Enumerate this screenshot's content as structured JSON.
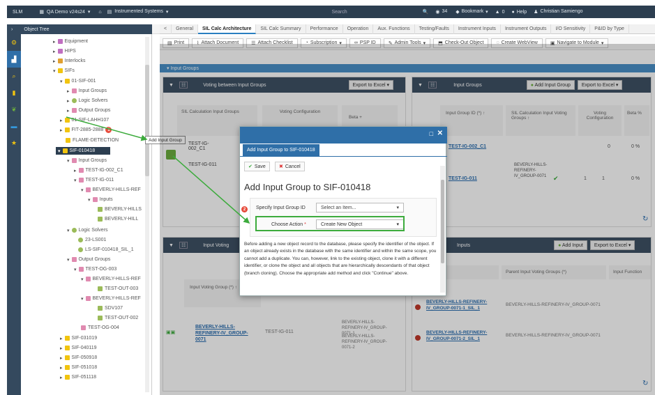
{
  "topbar": {
    "app": "SLM",
    "project": "QA Demo v24s24",
    "breadcrumb": "Instrumented Systems",
    "search": "Search",
    "count": "34",
    "bookmark": "Bookmark",
    "alerts": "0",
    "help": "Help",
    "user": "Christian Samiengo"
  },
  "tree": {
    "title": "Object Tree",
    "items": [
      "Equipment",
      "HIPS",
      "Interlocks",
      "SIFs",
      "01-SIF-001",
      "Input Groups",
      "Logic Solvers",
      "Output Groups",
      "01-SIF-LAHH107",
      "FIT-2885-2888",
      "FLAME-DETECTION",
      "SIF-010418",
      "Input Groups",
      "TEST-IG-002_C1",
      "TEST-IG-011",
      "BEVERLY-HILLS-REF",
      "Inputs",
      "BEVERLY-HILLS",
      "BEVERLY-HILL",
      "Logic Solvers",
      "23-LS001",
      "LS-SIF-010418_SIL_1",
      "Output Groups",
      "TEST-OG-003",
      "BEVERLY-HILLS-REF",
      "TEST-OUT-003",
      "BEVERLY-HILLS-REF",
      "SDV107",
      "TEST-OUT-002",
      "TEST-OG-004",
      "SIF-031019",
      "SIF-040119",
      "SIF-050918",
      "SIF-051018",
      "SIF-051118"
    ],
    "badge": "1"
  },
  "tabs": [
    "General",
    "SIL Calc Architecture",
    "SIL Calc Summary",
    "Performance",
    "Operation",
    "Aux. Functions",
    "Testing/Faults",
    "Instrument Inputs",
    "Instrument Outputs",
    "I/O Sensitivity",
    "P&ID by Type"
  ],
  "toolbar": [
    "Print",
    "Attach Document",
    "Attach Checklist",
    "Subscription",
    "PSP ID",
    "Admin Tools",
    "Check-Out Object",
    "Create WebView",
    "Navigate to Module"
  ],
  "input_groups_bar": "Input Groups",
  "left_panel": {
    "title": "Voting between Input Groups",
    "export": "Export to Excel",
    "col1": "SIL Calculation Input Groups",
    "col2": "Voting Configuration",
    "col3": "Beta + ",
    "rows": [
      "TEST-IG-002_C1",
      "TEST-IG-011"
    ],
    "tooltip": "Add Input Group"
  },
  "right_panel": {
    "title": "Input Groups",
    "add": "Add Input Group",
    "export": "Export to Excel",
    "col1": "Input Group ID (*) ↑",
    "col2": "SIL Calculation Input Voting Groups ↑",
    "col3": "Voting Configuration",
    "col4": "Beta %",
    "row1_id": "TEST-IG-002_C1",
    "row1_val1": "0",
    "row1_val2": "0 %",
    "row2_id": "TEST-IG-011",
    "row2_group": "BEVERLY-HILLS-REFINERY-IV_GROUP-0071",
    "row2_v1": "1",
    "row2_v2": "1",
    "row2_beta": "0 %"
  },
  "bottom_left": {
    "title": "Input Voting",
    "col": "Input Voting Group (*) ↑",
    "link": "BEVERLY-HILLS-REFINERY-IV_GROUP-0071",
    "mid": "TEST-IG-011",
    "right1": "BEVERLY-HILLS-REFINERY-IV_GROUP-0071-1",
    "right2": "BEVERLY-HILLS-REFINERY-IV_GROUP-0071-2"
  },
  "bottom_right": {
    "title": "Inputs",
    "add": "Add Input",
    "export": "Export to Excel",
    "col1": "(*) ↑",
    "col2": "Parent Input Voting Groups (*)",
    "col3": "Input Function",
    "row1_link": "BEVERLY-HILLS-REFINERY-IV_GROUP-0071-1_SIL_1",
    "row1_parent": "BEVERLY-HILLS-REFINERY-IV_GROUP-0071",
    "row2_link": "BEVERLY-HILLS-REFINERY-IV_GROUP-0071-2_SIL_1",
    "row2_parent": "BEVERLY-HILLS-REFINERY-IV_GROUP-0071"
  },
  "modal": {
    "tab": "Add Input Group to SIF-010418",
    "save": "Save",
    "cancel": "Cancel",
    "heading": "Add Input Group to SIF-010418",
    "specify_label": "Specify Input Group ID",
    "specify_placeholder": "Select an Item...",
    "action_label": "Choose Action",
    "action_value": "Create New Object",
    "badge": "2",
    "text": "Before adding a new object record to the database, please specify the identifier of the object. If an object already exists in the database with the same identifier and within the same scope, you cannot add a duplicate. You can, however, link to the existing object, clone it with a different identifier, or clone the object and all objects that are hierarchically descendants of that object (branch cloning). Choose the appropriate add method and click \"Continue\" above."
  },
  "colors": {
    "accent": "#2f6fa8",
    "green": "#3cab3c",
    "dark": "#34495e",
    "link": "#2a6eb0"
  }
}
